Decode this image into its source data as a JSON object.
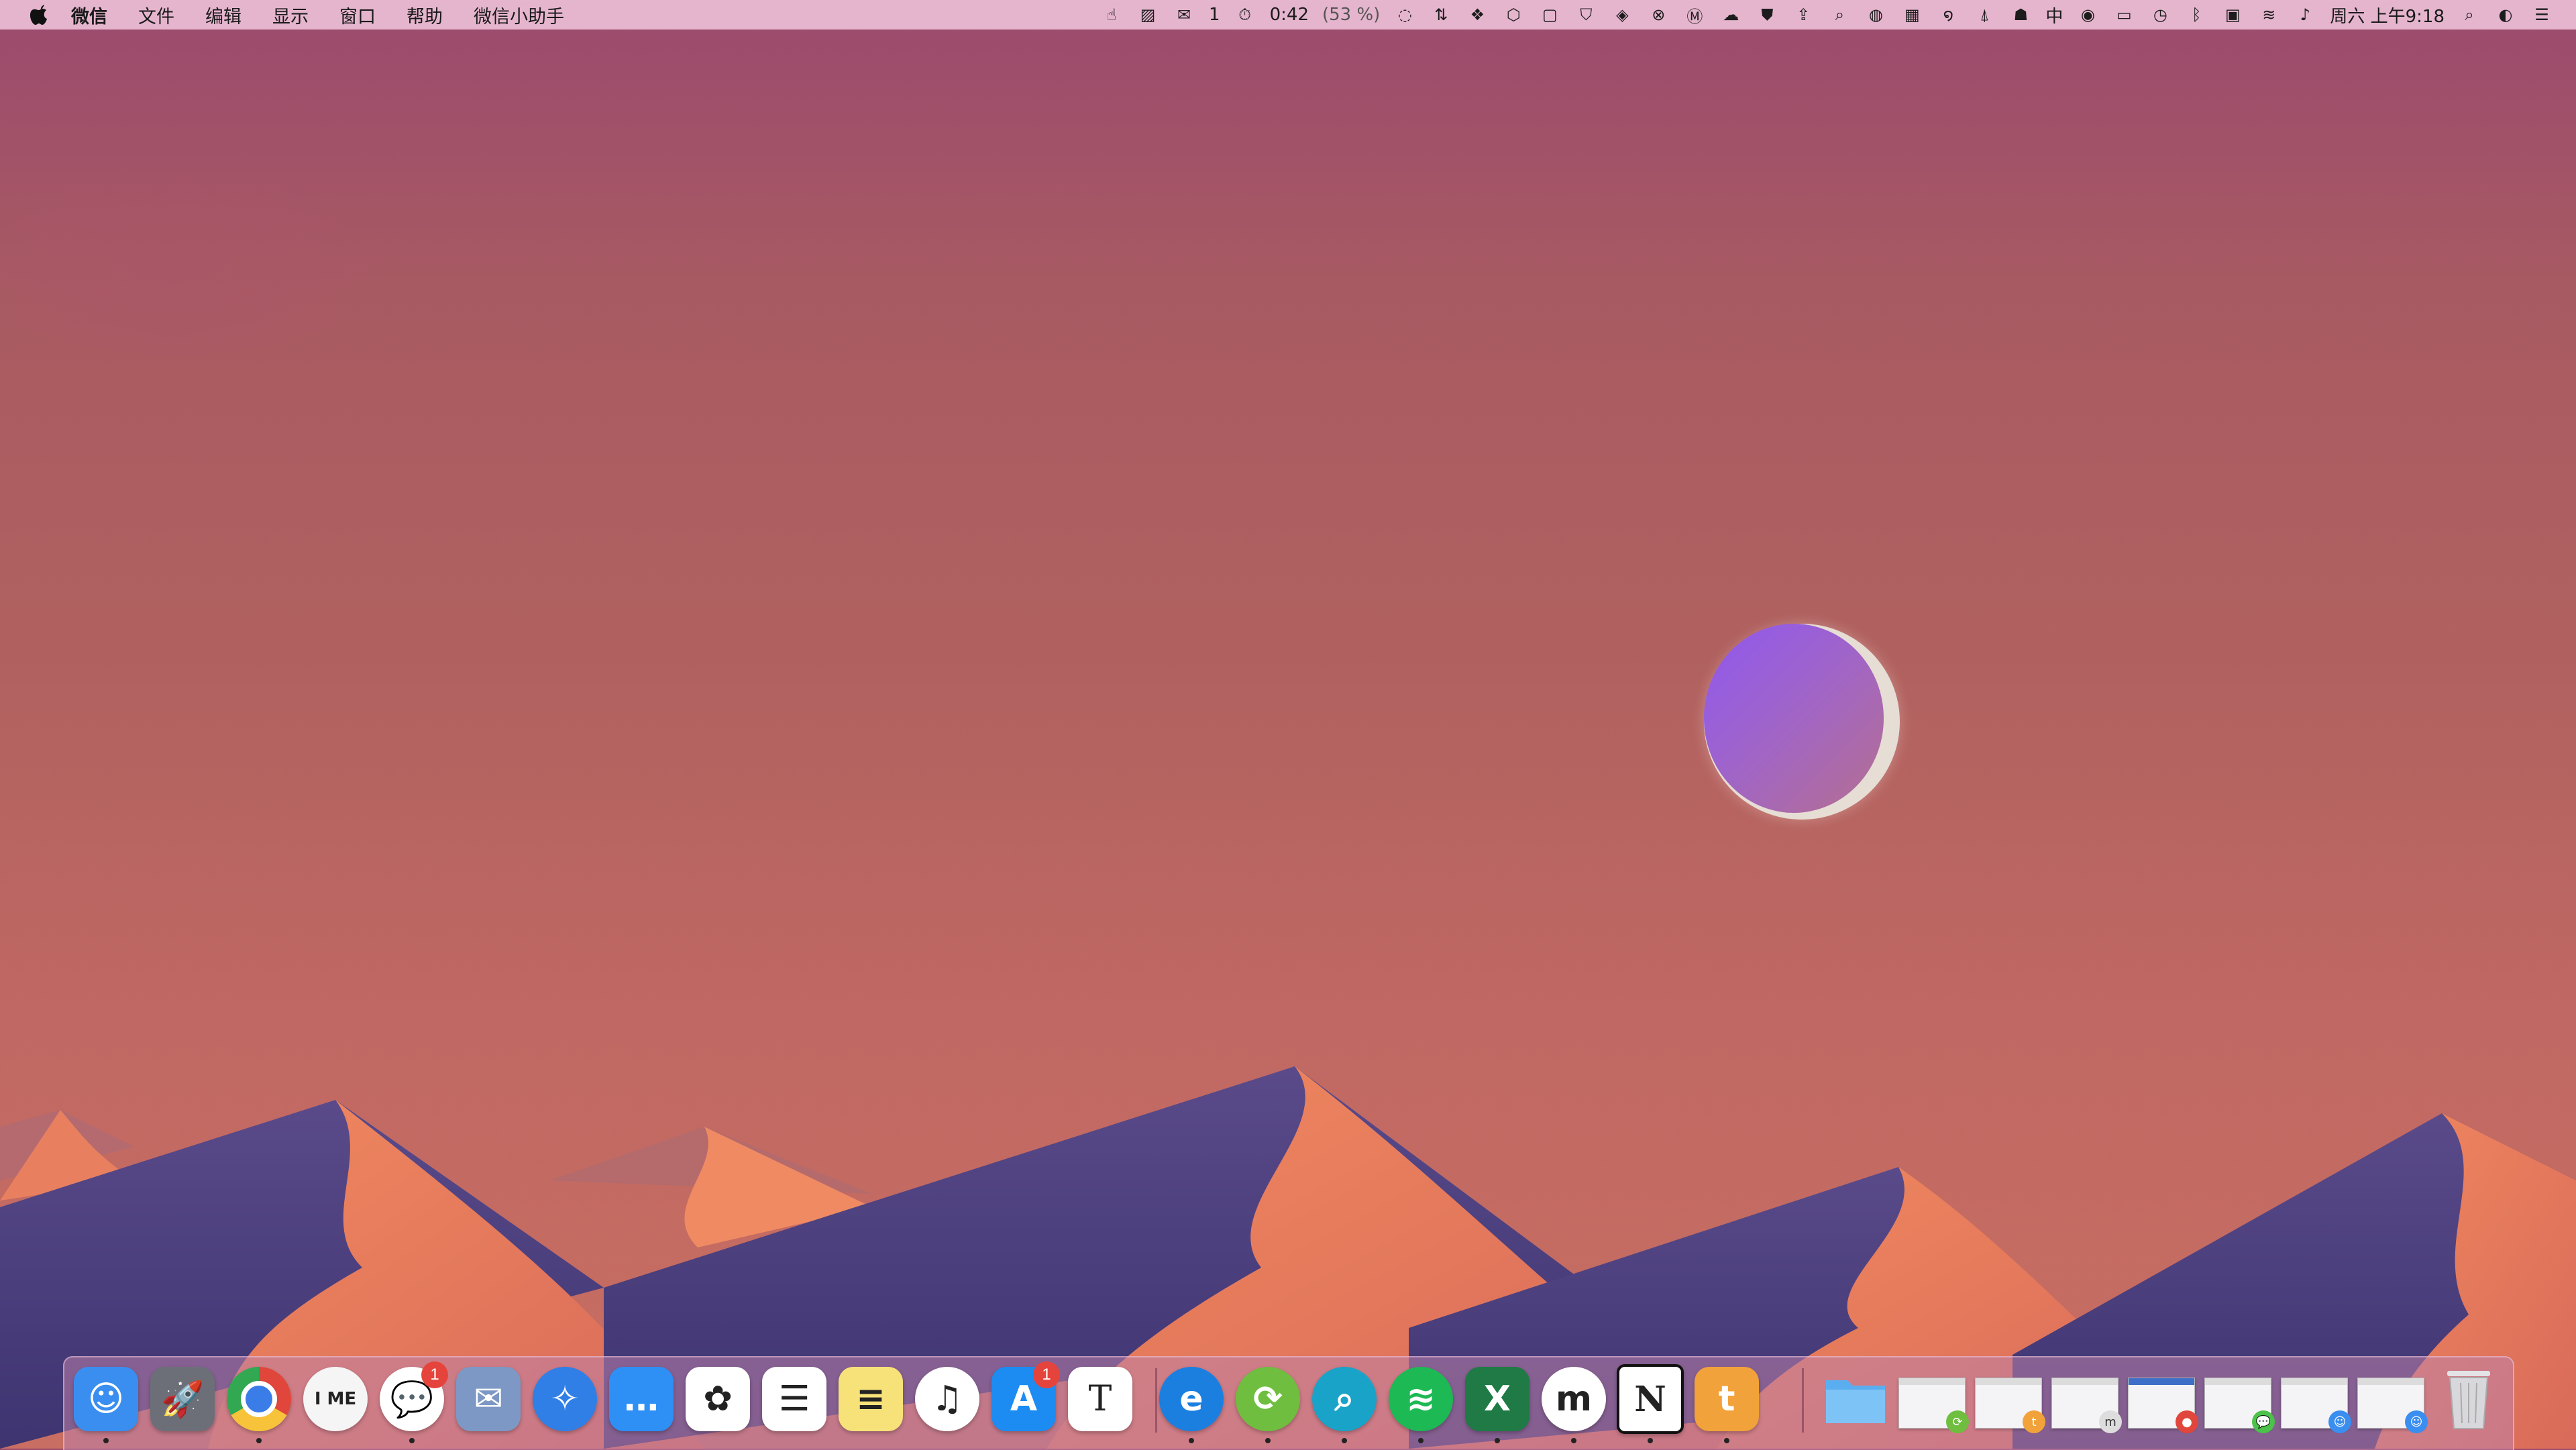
{
  "menubar": {
    "app_name": "微信",
    "menus": [
      "文件",
      "编辑",
      "显示",
      "窗口",
      "帮助",
      "微信小助手"
    ],
    "status": {
      "wechat_count": "1",
      "battery_time": "0:42",
      "battery_percent": "(53 %)",
      "input_method": "中",
      "datetime": "周六 上午9:18"
    }
  },
  "dock": {
    "apps": [
      {
        "name": "Finder",
        "icon": "finder-icon",
        "color": "#3a8ef0",
        "glyph": "☺",
        "running": true
      },
      {
        "name": "Launchpad",
        "icon": "launchpad-icon",
        "color": "#6d6f78",
        "glyph": "🚀",
        "running": false
      },
      {
        "name": "Google Chrome",
        "icon": "chrome-icon",
        "color": "#ffffff",
        "glyph": "",
        "running": true
      },
      {
        "name": "IME",
        "icon": "ime-icon",
        "color": "#f5f5f5",
        "glyph": "I ME",
        "running": false
      },
      {
        "name": "WeChat",
        "icon": "wechat-icon",
        "color": "#ffffff",
        "glyph": "💬",
        "running": true,
        "badge": "1"
      },
      {
        "name": "Mail",
        "icon": "mail-stamp-icon",
        "color": "#7d98c4",
        "glyph": "✉",
        "running": false
      },
      {
        "name": "Safari",
        "icon": "safari-compass-icon",
        "color": "#2f7fe6",
        "glyph": "✧",
        "running": false
      },
      {
        "name": "Messages",
        "icon": "messages-icon",
        "color": "#2e8ff5",
        "glyph": "…",
        "running": false
      },
      {
        "name": "Photos",
        "icon": "photos-icon",
        "color": "#ffffff",
        "glyph": "✿",
        "running": false
      },
      {
        "name": "Reminders",
        "icon": "reminders-icon",
        "color": "#ffffff",
        "glyph": "☰",
        "running": false
      },
      {
        "name": "Notes",
        "icon": "notes-icon",
        "color": "#f7e27a",
        "glyph": "≡",
        "running": false
      },
      {
        "name": "Music",
        "icon": "music-note-icon",
        "color": "#ffffff",
        "glyph": "♫",
        "running": false
      },
      {
        "name": "App Store",
        "icon": "app-store-icon",
        "color": "#1c8cf2",
        "glyph": "A",
        "running": false,
        "badge": "1"
      },
      {
        "name": "Typora",
        "icon": "typora-t-icon",
        "color": "#ffffff",
        "glyph": "T",
        "running": false
      },
      {
        "name": "Edge",
        "icon": "edge-icon",
        "color": "#1b7fe0",
        "glyph": "e",
        "running": true
      },
      {
        "name": "Sync",
        "icon": "sync-arrows-icon",
        "color": "#6fbe3f",
        "glyph": "⟳",
        "running": true
      },
      {
        "name": "Search",
        "icon": "magnifier-app-icon",
        "color": "#1aa3c8",
        "glyph": "⌕",
        "running": true
      },
      {
        "name": "Spotify",
        "icon": "spotify-icon",
        "color": "#1db954",
        "glyph": "≋",
        "running": true
      },
      {
        "name": "Excel",
        "icon": "excel-icon",
        "color": "#1f7a45",
        "glyph": "X",
        "running": true
      },
      {
        "name": "Mweb",
        "icon": "m-letter-icon",
        "color": "#ffffff",
        "glyph": "m",
        "running": true
      },
      {
        "name": "Notion",
        "icon": "notion-icon",
        "color": "#ffffff",
        "glyph": "N",
        "running": true
      },
      {
        "name": "Toolbox",
        "icon": "orange-t-icon",
        "color": "#f2a23a",
        "glyph": "t",
        "running": true
      }
    ]
  }
}
